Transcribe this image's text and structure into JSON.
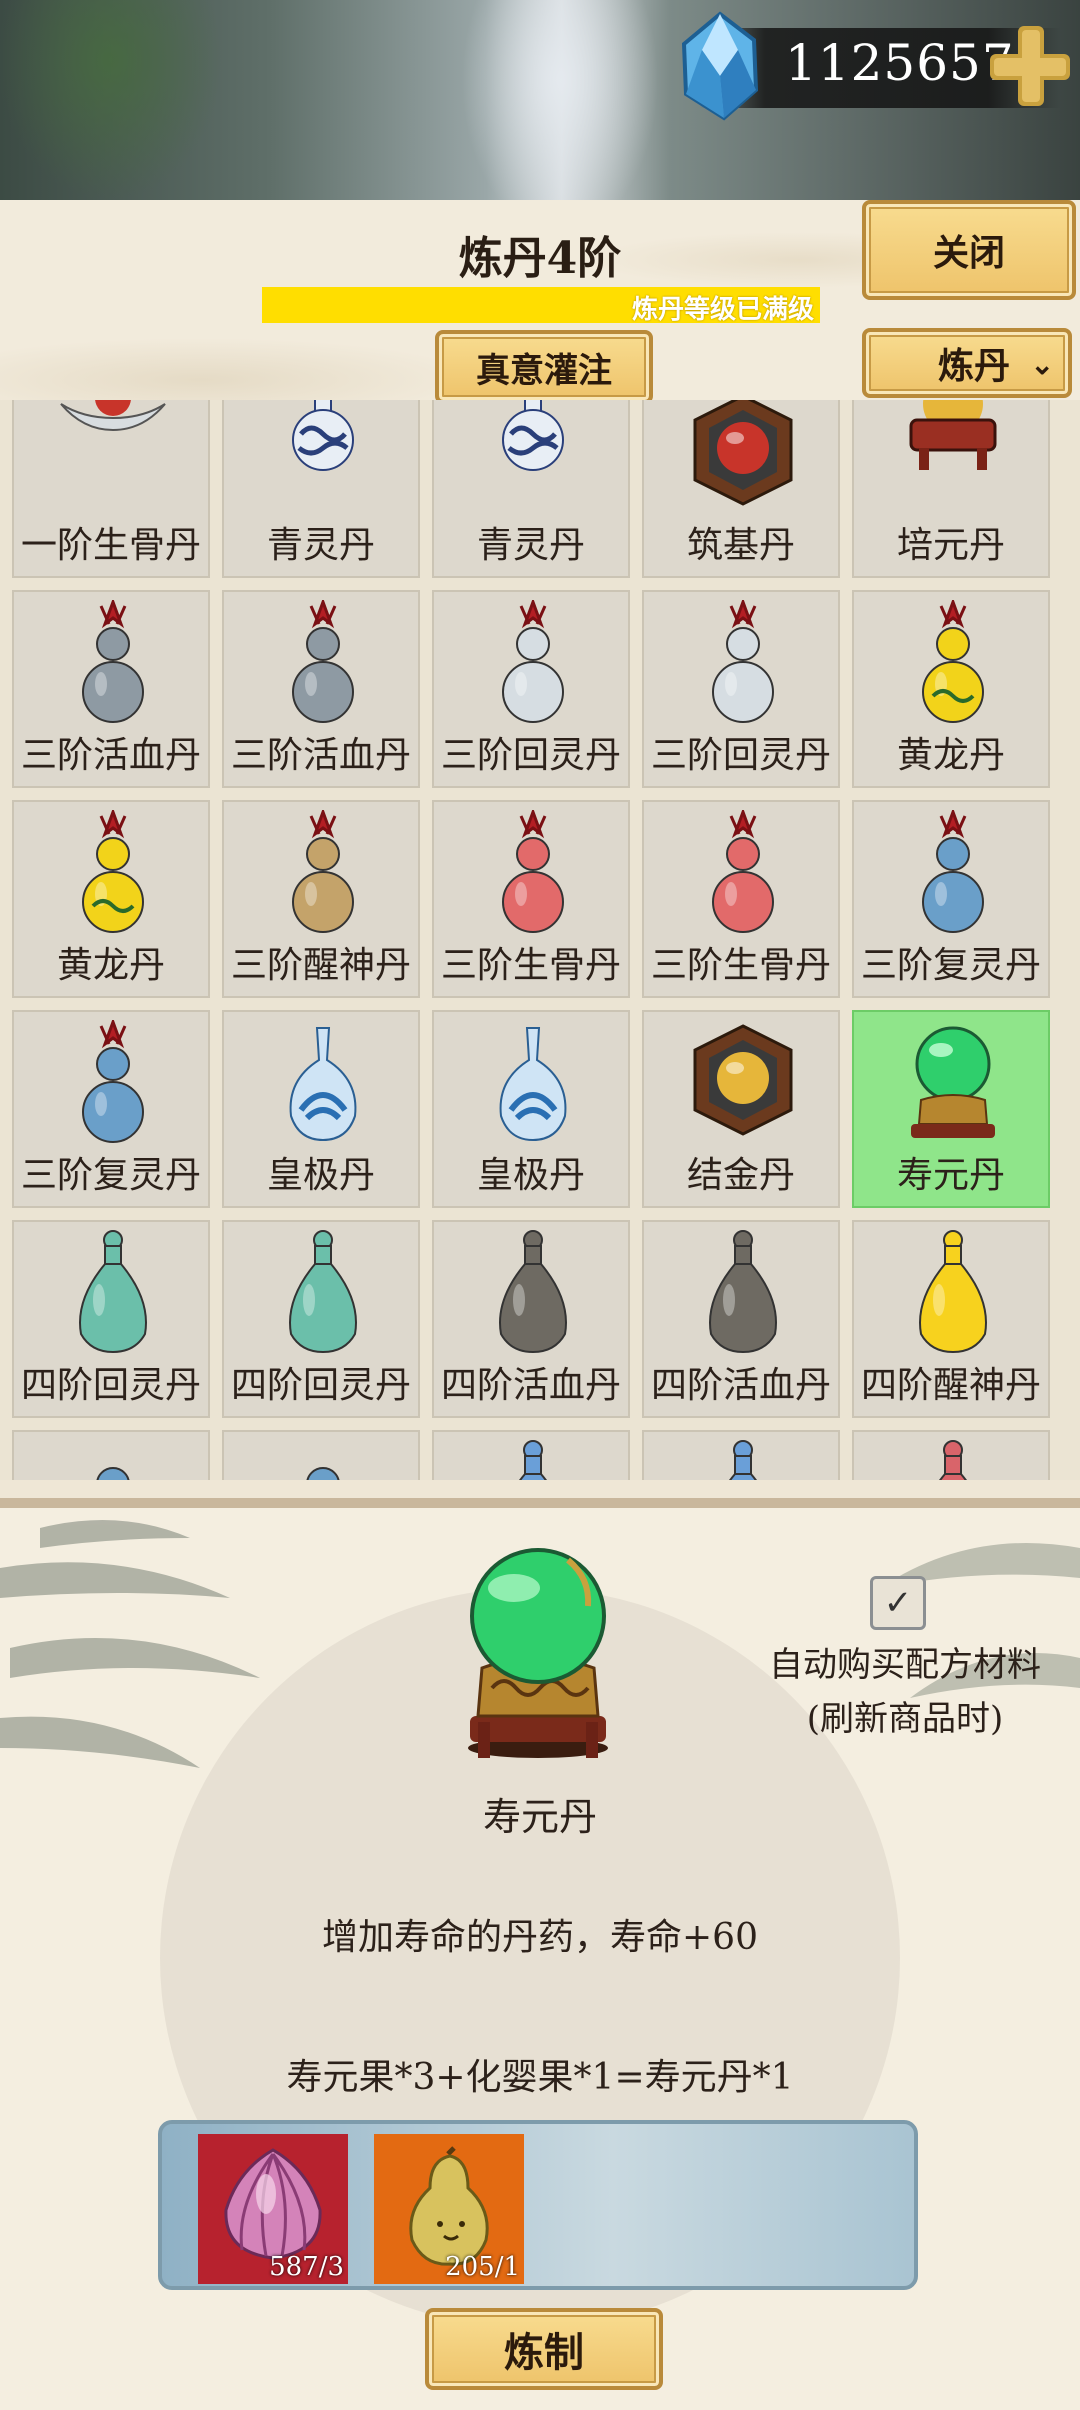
{
  "currency": {
    "icon": "blue-gem-icon",
    "value": "1125657",
    "add_icon": "plus-icon"
  },
  "header": {
    "title": "炼丹4阶",
    "progress_fraction": 1.0,
    "progress_text": "炼丹等级已满级",
    "close_label": "关闭",
    "infuse_label": "真意灌注",
    "category_label": "炼丹",
    "accent_color": "#ffde00"
  },
  "grid": {
    "items": [
      {
        "label": "一阶生骨丹",
        "icon": "silver-dish-icon"
      },
      {
        "label": "青灵丹",
        "icon": "blue-white-vase-icon"
      },
      {
        "label": "青灵丹",
        "icon": "blue-white-vase-icon"
      },
      {
        "label": "筑基丹",
        "icon": "red-pearl-box-icon"
      },
      {
        "label": "培元丹",
        "icon": "golden-orb-stand-icon"
      },
      {
        "label": "三阶活血丹",
        "icon": "grey-gourd-icon"
      },
      {
        "label": "三阶活血丹",
        "icon": "grey-gourd-icon"
      },
      {
        "label": "三阶回灵丹",
        "icon": "white-gourd-icon"
      },
      {
        "label": "三阶回灵丹",
        "icon": "white-gourd-icon"
      },
      {
        "label": "黄龙丹",
        "icon": "yellow-dragon-gourd-icon"
      },
      {
        "label": "黄龙丹",
        "icon": "yellow-dragon-gourd-icon"
      },
      {
        "label": "三阶醒神丹",
        "icon": "tan-gourd-icon"
      },
      {
        "label": "三阶生骨丹",
        "icon": "red-gourd-icon"
      },
      {
        "label": "三阶生骨丹",
        "icon": "red-gourd-icon"
      },
      {
        "label": "三阶复灵丹",
        "icon": "blue-gourd-icon"
      },
      {
        "label": "三阶复灵丹",
        "icon": "blue-gourd-icon"
      },
      {
        "label": "皇极丹",
        "icon": "lotus-vase-icon"
      },
      {
        "label": "皇极丹",
        "icon": "lotus-vase-icon"
      },
      {
        "label": "结金丹",
        "icon": "golden-pearl-box-icon"
      },
      {
        "label": "寿元丹",
        "icon": "jade-orb-stand-icon",
        "selected": true
      },
      {
        "label": "四阶回灵丹",
        "icon": "teal-bottle-icon"
      },
      {
        "label": "四阶回灵丹",
        "icon": "teal-bottle-icon"
      },
      {
        "label": "四阶活血丹",
        "icon": "dark-bottle-icon"
      },
      {
        "label": "四阶活血丹",
        "icon": "dark-bottle-icon"
      },
      {
        "label": "四阶醒神丹",
        "icon": "yellow-bottle-icon"
      },
      {
        "label": "",
        "icon": "blue-gourd-partial-icon"
      },
      {
        "label": "",
        "icon": "blue-gourd-partial-icon"
      },
      {
        "label": "",
        "icon": "blue-bottle-partial-icon"
      },
      {
        "label": "",
        "icon": "blue-bottle-partial-icon"
      },
      {
        "label": "",
        "icon": "red-bottle-partial-icon"
      }
    ],
    "selected_color": "#8fe58a"
  },
  "detail": {
    "icon": "jade-orb-stand-icon",
    "name": "寿元丹",
    "auto_buy_checked": true,
    "auto_buy_label": "自动购买配方材料",
    "auto_buy_note": "(刷新商品时)",
    "description": "增加寿命的丹药，寿命+60",
    "recipe": "寿元果*3+化婴果*1=寿元丹*1",
    "ingredients": [
      {
        "icon": "longevity-fruit-icon",
        "count": "587/3"
      },
      {
        "icon": "infant-fruit-icon",
        "count": "205/1"
      }
    ],
    "craft_label": "炼制"
  }
}
